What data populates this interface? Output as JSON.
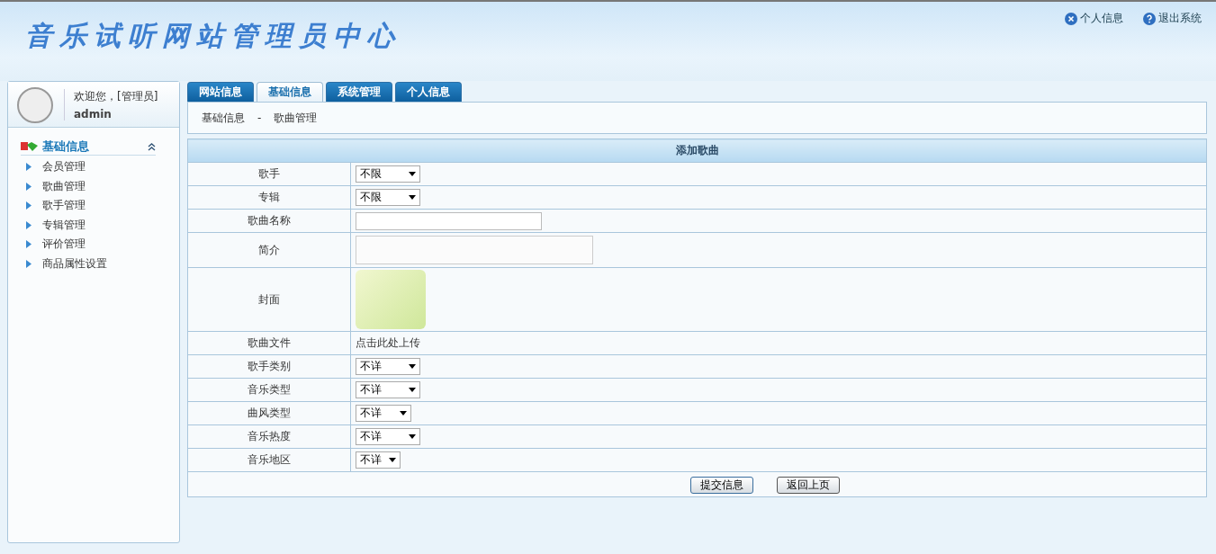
{
  "header": {
    "title": "音乐试听网站管理员中心",
    "links": [
      {
        "label": "个人信息",
        "kind": "close"
      },
      {
        "label": "退出系统",
        "kind": "help"
      }
    ]
  },
  "sidebar": {
    "welcome": "欢迎您，[管理员]",
    "user": "admin",
    "section": {
      "title": "基础信息",
      "expanded": true
    },
    "items": [
      "会员管理",
      "歌曲管理",
      "歌手管理",
      "专辑管理",
      "评价管理",
      "商品属性设置"
    ]
  },
  "tabs": [
    {
      "label": "网站信息",
      "selected": false
    },
    {
      "label": "基础信息",
      "selected": true
    },
    {
      "label": "系统管理",
      "selected": false
    },
    {
      "label": "个人信息",
      "selected": false
    }
  ],
  "breadcrumb": [
    "基础信息",
    "-",
    "歌曲管理"
  ],
  "form": {
    "title": "添加歌曲",
    "rows": [
      {
        "label": "歌手",
        "kind": "select",
        "value": "不限"
      },
      {
        "label": "专辑",
        "kind": "select",
        "value": "不限"
      },
      {
        "label": "歌曲名称",
        "kind": "text"
      },
      {
        "label": "简介",
        "kind": "textarea"
      },
      {
        "label": "封面",
        "kind": "image"
      },
      {
        "label": "歌曲文件",
        "kind": "link",
        "value": "点击此处上传"
      },
      {
        "label": "歌手类别",
        "kind": "select",
        "value": "不详"
      },
      {
        "label": "音乐类型",
        "kind": "select",
        "value": "不详"
      },
      {
        "label": "曲风类型",
        "kind": "select",
        "value": "不详"
      },
      {
        "label": "音乐热度",
        "kind": "select",
        "value": "不详"
      },
      {
        "label": "音乐地区",
        "kind": "select",
        "value": "不详"
      }
    ],
    "buttons": [
      "提交信息",
      "返回上页"
    ]
  }
}
